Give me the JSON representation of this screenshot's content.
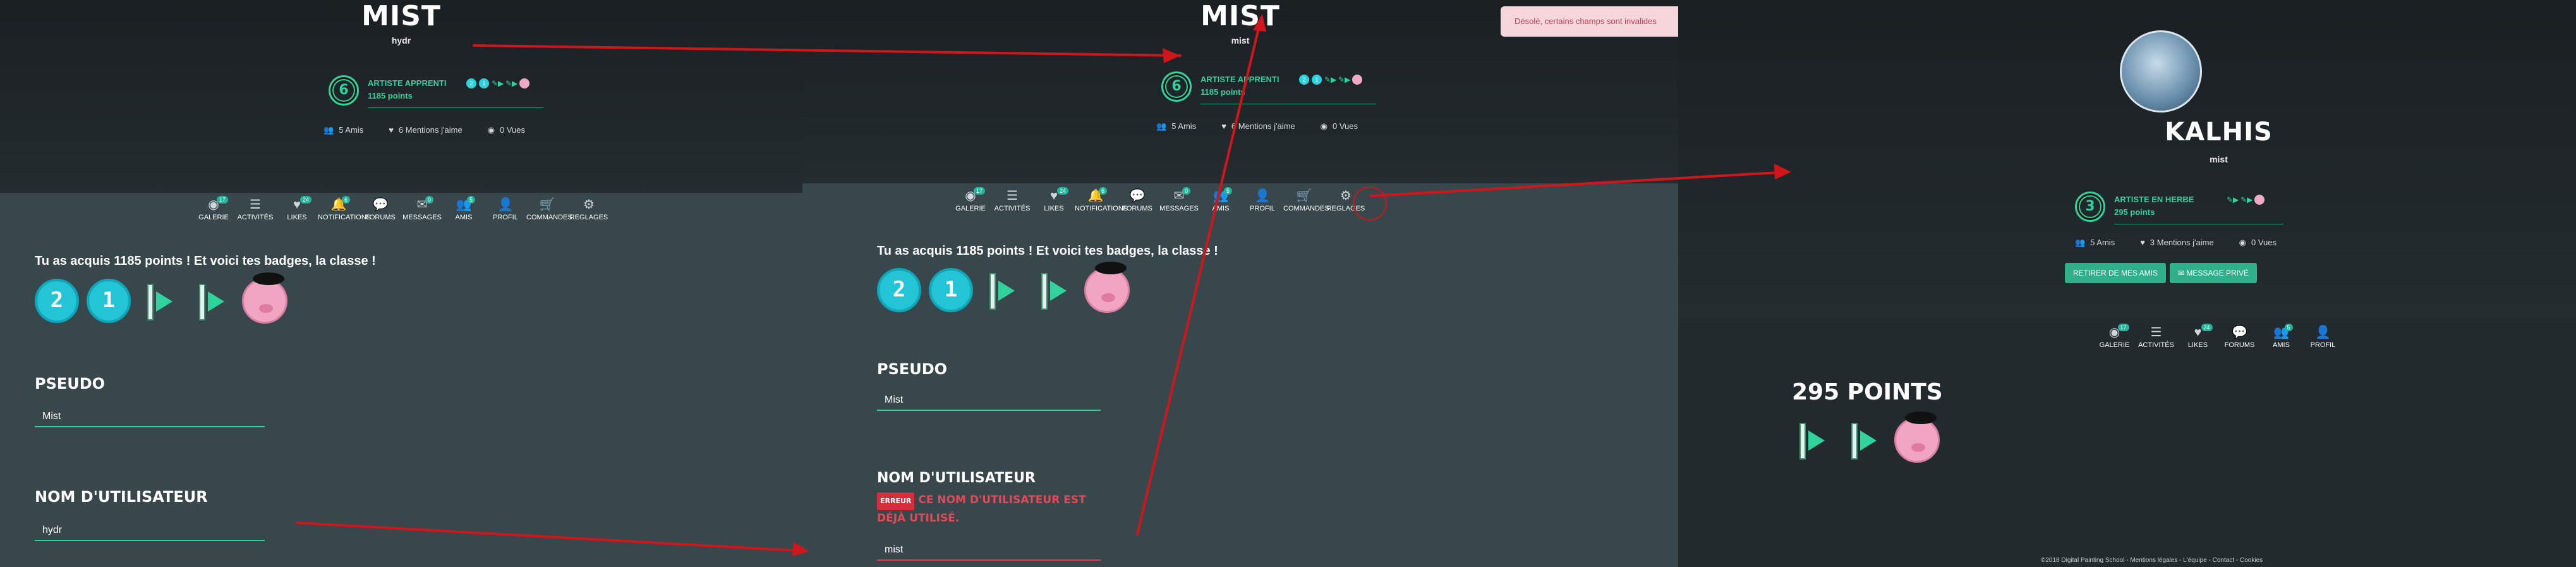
{
  "colors": {
    "accent": "#2fd39b",
    "hero_bg": "#1f2629",
    "content_bg": "#38474c",
    "error": "#e03b4e",
    "arrow": "#d0161b"
  },
  "panel1": {
    "title": "MIST",
    "subtitle": "hydr",
    "level": "6",
    "rank": "ARTISTE APPRENTI",
    "points": "1185 points",
    "stats": {
      "friends": "5 Amis",
      "likes": "6 Mentions j'aime",
      "views": "0 Vues"
    },
    "badges_message": "Tu as acquis 1185 points ! Et voici tes badges, la classe !",
    "pseudo_label": "PSEUDO",
    "pseudo_value": "Mist",
    "username_label": "NOM D'UTILISATEUR",
    "username_value": "hydr"
  },
  "panel2": {
    "title": "MIST",
    "subtitle": "mist",
    "level": "6",
    "rank": "ARTISTE APPRENTI",
    "points": "1185 points",
    "stats": {
      "friends": "5 Amis",
      "likes": "6 Mentions j'aime",
      "views": "0 Vues"
    },
    "toast": "Désolé, certains champs sont invalides",
    "badges_message": "Tu as acquis 1185 points ! Et voici tes badges, la classe !",
    "pseudo_label": "PSEUDO",
    "pseudo_value": "Mist",
    "username_label": "NOM D'UTILISATEUR",
    "error_badge": "ERREUR",
    "error_line1": "CE NOM D'UTILISATEUR EST",
    "error_line2": "DÉJÀ UTILISÉ.",
    "username_value": "mist"
  },
  "panel3": {
    "title": "KALHIS",
    "subtitle": "mist",
    "level": "3",
    "rank": "ARTISTE EN HERBE",
    "points": "295 points",
    "stats": {
      "friends": "5 Amis",
      "likes": "3 Mentions j'aime",
      "views": "0 Vues"
    },
    "btn_remove": "RETIRER DE MES AMIS",
    "btn_message": "✉ MESSAGE PRIVÉ",
    "points_heading": "295 POINTS",
    "footer": "©2018 Digital Painting School - Mentions légales - L'équipe - Contact - Cookies"
  },
  "nav_full": [
    {
      "label": "GALERIE",
      "icon": "gallery-icon",
      "glyph": "◉",
      "badge": "17"
    },
    {
      "label": "ACTIVITÉS",
      "icon": "list-icon",
      "glyph": "☰",
      "badge": ""
    },
    {
      "label": "LIKES",
      "icon": "like-icon",
      "glyph": "♥",
      "badge": "24"
    },
    {
      "label": "NOTIFICATIONS",
      "icon": "bell-icon",
      "glyph": "🔔",
      "badge": "6"
    },
    {
      "label": "FORUMS",
      "icon": "forum-icon",
      "glyph": "💬",
      "badge": ""
    },
    {
      "label": "MESSAGES",
      "icon": "mail-icon",
      "glyph": "✉",
      "badge": "0"
    },
    {
      "label": "AMIS",
      "icon": "friends-icon",
      "glyph": "👥",
      "badge": "5"
    },
    {
      "label": "PROFIL",
      "icon": "user-icon",
      "glyph": "👤",
      "badge": ""
    },
    {
      "label": "COMMANDES",
      "icon": "cart-icon",
      "glyph": "🛒",
      "badge": ""
    },
    {
      "label": "REGLAGES",
      "icon": "gear-icon",
      "glyph": "⚙",
      "badge": ""
    }
  ],
  "nav_short": [
    {
      "label": "GALERIE",
      "icon": "gallery-icon",
      "glyph": "◉",
      "badge": "17"
    },
    {
      "label": "ACTIVITÉS",
      "icon": "list-icon",
      "glyph": "☰",
      "badge": ""
    },
    {
      "label": "LIKES",
      "icon": "like-icon",
      "glyph": "♥",
      "badge": "24"
    },
    {
      "label": "FORUMS",
      "icon": "forum-icon",
      "glyph": "💬",
      "badge": ""
    },
    {
      "label": "AMIS",
      "icon": "friends-icon",
      "glyph": "👥",
      "badge": "5"
    },
    {
      "label": "PROFIL",
      "icon": "user-icon",
      "glyph": "👤",
      "badge": ""
    }
  ]
}
